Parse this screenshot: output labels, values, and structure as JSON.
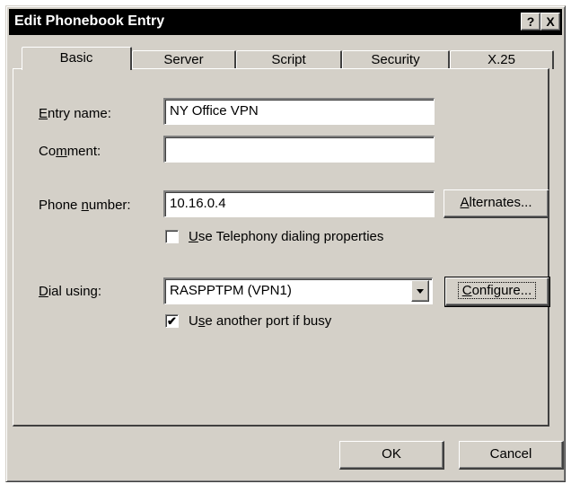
{
  "window": {
    "title": "Edit Phonebook Entry",
    "help_glyph": "?",
    "close_glyph": "X"
  },
  "tabs": [
    {
      "label": "Basic",
      "active": true
    },
    {
      "label": "Server"
    },
    {
      "label": "Script"
    },
    {
      "label": "Security"
    },
    {
      "label": "X.25"
    }
  ],
  "form": {
    "entry_name": {
      "label_pre": "",
      "label_key": "E",
      "label_post": "ntry name:",
      "value": "NY Office VPN"
    },
    "comment": {
      "label_pre": "Co",
      "label_key": "m",
      "label_post": "ment:",
      "value": ""
    },
    "phone_number": {
      "label_pre": "Phone ",
      "label_key": "n",
      "label_post": "umber:",
      "value": "10.16.0.4"
    },
    "alternates": {
      "pre": "",
      "key": "A",
      "post": "lternates..."
    },
    "telephony": {
      "key": "U",
      "post": "se Telephony dialing properties",
      "checked": false
    },
    "dial_using": {
      "label_pre": "",
      "label_key": "D",
      "label_post": "ial using:",
      "value": "RASPPTPM (VPN1)"
    },
    "configure": {
      "pre": "",
      "key": "C",
      "post": "onfigure..."
    },
    "another_port": {
      "pre": "U",
      "key": "s",
      "post": "e another port if busy",
      "checked": true,
      "mark": "✔"
    }
  },
  "buttons": {
    "ok": "OK",
    "cancel": "Cancel"
  }
}
